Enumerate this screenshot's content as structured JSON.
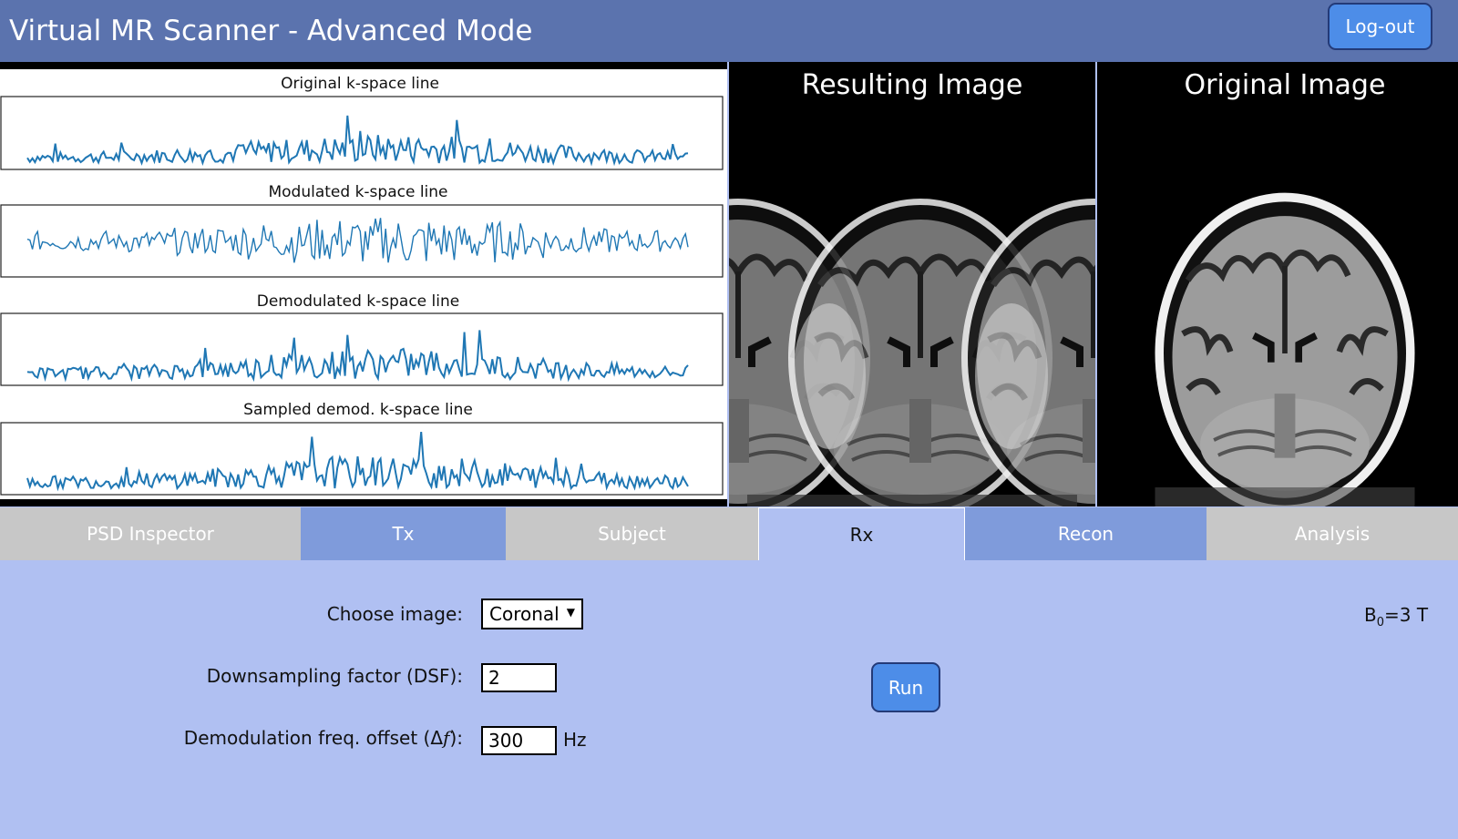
{
  "header": {
    "title": "Virtual MR Scanner - Advanced Mode",
    "logout_label": "Log-out"
  },
  "plots": {
    "titles": [
      "Original k-space line",
      "Modulated k-space line",
      "Demodulated k-space line",
      "Sampled demod. k-space line"
    ]
  },
  "images": {
    "resulting_title": "Resulting Image",
    "original_title": "Original Image"
  },
  "tabs": [
    "PSD Inspector",
    "Tx",
    "Subject",
    "Rx",
    "Recon",
    "Analysis"
  ],
  "active_tab": "Rx",
  "form": {
    "choose_image_label": "Choose image:",
    "choose_image_value": "Coronal",
    "dsf_label": "Downsampling factor (DSF):",
    "dsf_value": "2",
    "freq_label_prefix": "Demodulation freq. offset (",
    "freq_label_symbol": "Δ",
    "freq_label_var": "f",
    "freq_label_suffix": "):",
    "freq_value": "300",
    "freq_unit": "Hz",
    "run_label": "Run",
    "b0_prefix": "B",
    "b0_sub": "0",
    "b0_suffix": "=3 T"
  },
  "colors": {
    "header": "#5b73ae",
    "panel": "#b0c0f2",
    "button": "#4d8de8",
    "signal": "#1f77b4"
  }
}
